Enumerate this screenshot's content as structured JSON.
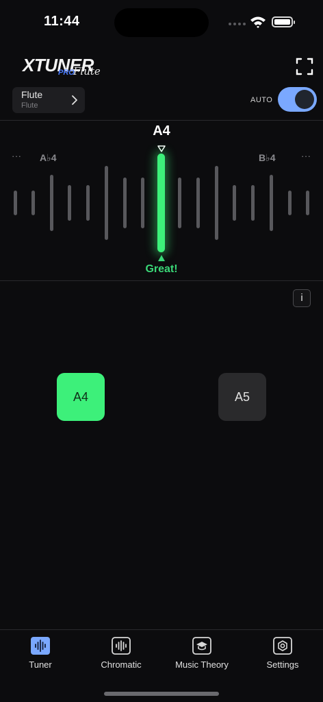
{
  "status_bar": {
    "time": "11:44"
  },
  "brand": {
    "name": "XTUNER",
    "edition": "PRO",
    "product": "Flute"
  },
  "instrument": {
    "name": "Flute",
    "subtitle": "Flute"
  },
  "auto_toggle": {
    "label": "AUTO",
    "on": true,
    "accent": "#7aa8ff"
  },
  "tuner": {
    "target_note": "A4",
    "lower_note": "A♭4",
    "upper_note": "B♭4",
    "more_left": "···",
    "more_right": "···",
    "status": "Great!",
    "in_tune_color": "#3df07a"
  },
  "info_button": {
    "label": "i"
  },
  "notes": [
    {
      "label": "A4",
      "active": true
    },
    {
      "label": "A5",
      "active": false
    }
  ],
  "tabs": [
    {
      "label": "Tuner",
      "icon": "tuner-waveform-icon",
      "active": true
    },
    {
      "label": "Chromatic",
      "icon": "chromatic-wave-icon",
      "active": false
    },
    {
      "label": "Music Theory",
      "icon": "graduation-cap-icon",
      "active": false
    },
    {
      "label": "Settings",
      "icon": "hex-gear-icon",
      "active": false
    }
  ]
}
